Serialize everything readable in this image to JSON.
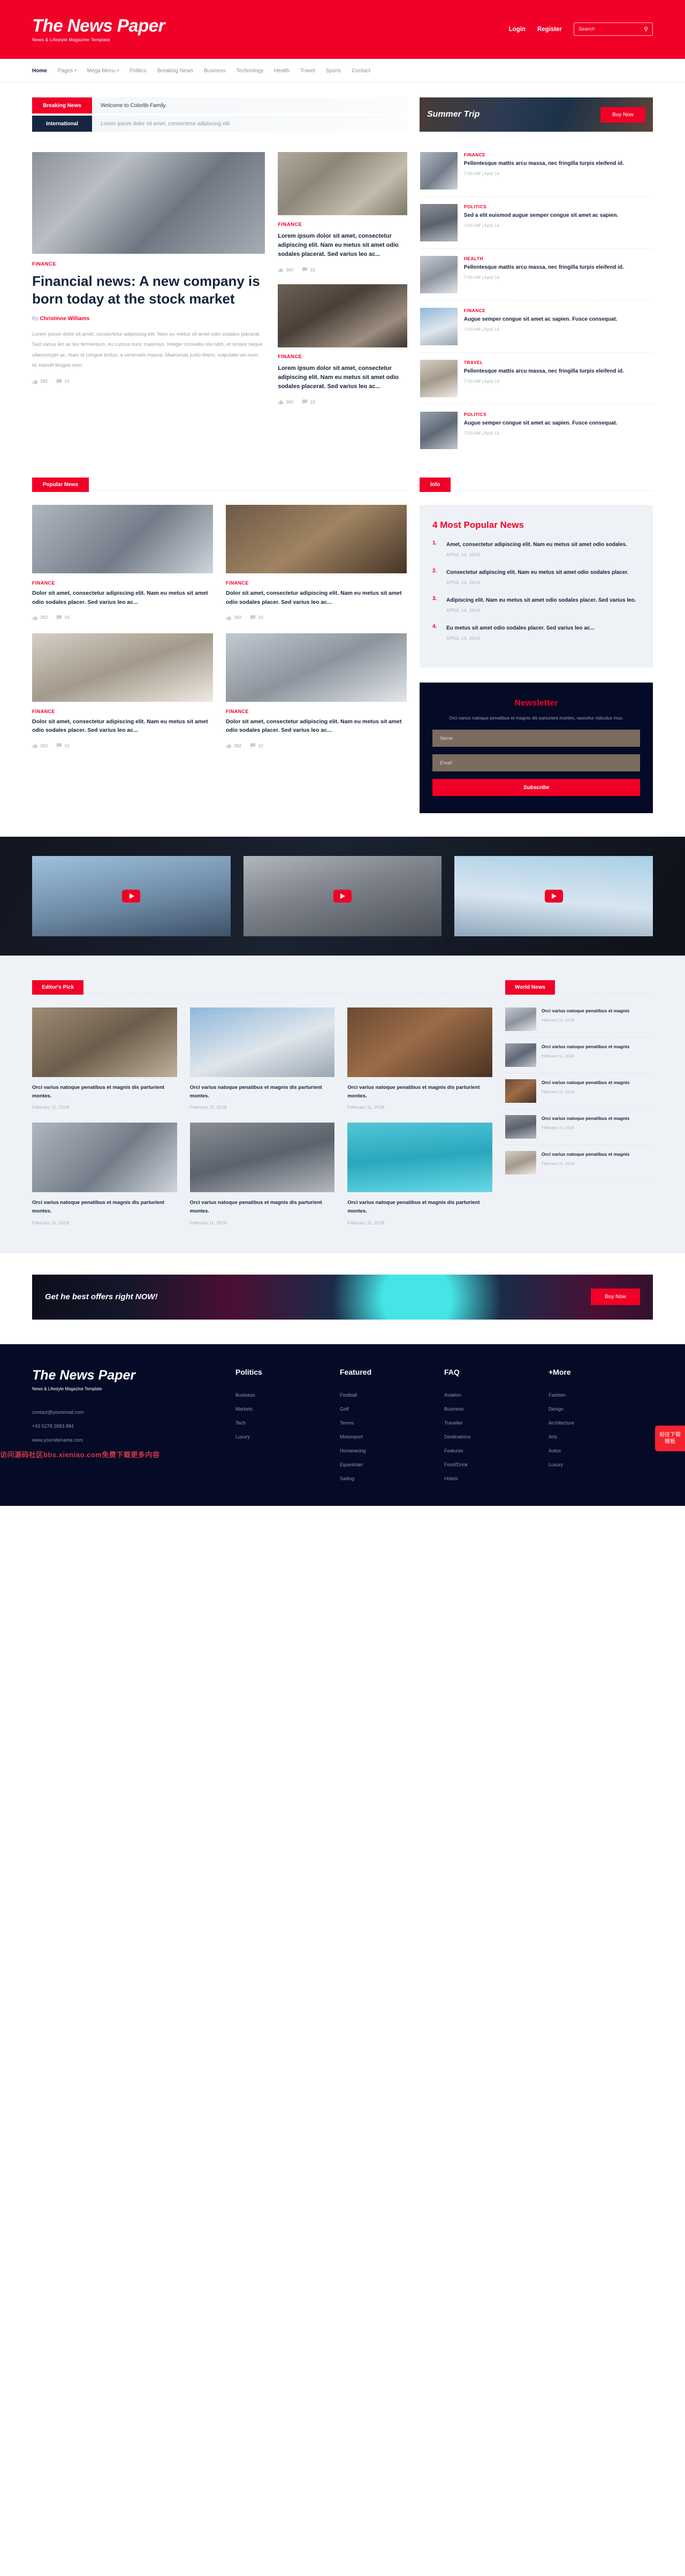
{
  "brand": {
    "title": "The News Paper",
    "tagline": "News & Lifestyle Magazine Template"
  },
  "header": {
    "login": "Login",
    "register": "Register",
    "search_placeholder": "Search",
    "search_value": "",
    "search_icon": "search-icon"
  },
  "nav": [
    {
      "label": "Home",
      "caret": "",
      "active": true
    },
    {
      "label": "Pages",
      "caret": "⌄",
      "active": false
    },
    {
      "label": "Mega Menu",
      "caret": "⌄",
      "active": false
    },
    {
      "label": "Politics",
      "caret": "",
      "active": false
    },
    {
      "label": "Breaking News",
      "caret": "",
      "active": false
    },
    {
      "label": "Business",
      "caret": "",
      "active": false
    },
    {
      "label": "Technology",
      "caret": "",
      "active": false
    },
    {
      "label": "Health",
      "caret": "",
      "active": false
    },
    {
      "label": "Travel",
      "caret": "",
      "active": false
    },
    {
      "label": "Sports",
      "caret": "",
      "active": false
    },
    {
      "label": "Contact",
      "caret": "",
      "active": false
    }
  ],
  "tickers": [
    {
      "tag": "Breaking News",
      "text": "Welcome to Colorlib Family."
    },
    {
      "tag": "International",
      "text": "Lorem ipsum dolor sit amet, consectetur adipiscing elit."
    }
  ],
  "promo": {
    "title": "Summer Trip",
    "button": "Buy Now"
  },
  "hero": {
    "category": "FINANCE",
    "title": "Financial news: A new company is born today at the stock market",
    "by_prefix": "By",
    "author": "Christinne Williams",
    "body": "Lorem ipsum dolor sit amet, consectetur adipiscing elit. Nam eu metus sit amet odio sodales placerat. Sed varius leo ac leo fermentum, eu cursus nunc maximus. Integer convallis nisi nibh, et ornare neque ullamcorper ac. Nam id congue lectus, a venenatis massa. Maecenas justo libero, vulputate vel nunc id, blandit feugiat sem.",
    "likes": "392",
    "comments": "10"
  },
  "hero_mid": [
    {
      "category": "FINANCE",
      "title": "Lorem ipsum dolor sit amet, consectetur adipiscing elit. Nam eu metus sit amet odio sodales placerat. Sed varius leo ac...",
      "likes": "392",
      "comments": "10"
    },
    {
      "category": "FINANCE",
      "title": "Lorem ipsum dolor sit amet, consectetur adipiscing elit. Nam eu metus sit amet odio sodales placerat. Sed varius leo ac...",
      "likes": "392",
      "comments": "10"
    }
  ],
  "sidebar_news": [
    {
      "category": "FINANCE",
      "title": "Pellentesque mattis arcu massa, nec fringilla turpis eleifend id.",
      "time": "7:00 AM | April 14"
    },
    {
      "category": "POLITICS",
      "title": "Sed a elit euismod augue semper congue sit amet ac sapien.",
      "time": "7:00 AM | April 14"
    },
    {
      "category": "HEALTH",
      "title": "Pellentesque mattis arcu massa, nec fringilla turpis eleifend id.",
      "time": "7:00 AM | April 14"
    },
    {
      "category": "FINANCE",
      "title": "Augue semper congue sit amet ac sapien. Fusce consequat.",
      "time": "7:00 AM | April 14"
    },
    {
      "category": "TRAVEL",
      "title": "Pellentesque mattis arcu massa, nec fringilla turpis eleifend id.",
      "time": "7:00 AM | April 14"
    },
    {
      "category": "POLITICS",
      "title": "Augue semper congue sit amet ac sapien. Fusce consequat.",
      "time": "7:00 AM | April 14"
    }
  ],
  "sections": {
    "popular_news": "Popular News",
    "info": "Info",
    "editors_pick": "Editor's Pick",
    "world_news": "World News"
  },
  "popular_cards": [
    {
      "category": "FINANCE",
      "title": "Dolor sit amet, consectetur adipiscing elit. Nam eu metus sit amet odio sodales placer. Sed varius leo ac...",
      "likes": "392",
      "comments": "10"
    },
    {
      "category": "FINANCE",
      "title": "Dolor sit amet, consectetur adipiscing elit. Nam eu metus sit amet odio sodales placer. Sed varius leo ac...",
      "likes": "392",
      "comments": "10"
    },
    {
      "category": "FINANCE",
      "title": "Dolor sit amet, consectetur adipiscing elit. Nam eu metus sit amet odio sodales placer. Sed varius leo ac...",
      "likes": "392",
      "comments": "10"
    },
    {
      "category": "FINANCE",
      "title": "Dolor sit amet, consectetur adipiscing elit. Nam eu metus sit amet odio sodales placer. Sed varius leo ac...",
      "likes": "392",
      "comments": "10"
    }
  ],
  "popular_widget": {
    "heading": "4 Most Popular News",
    "items": [
      {
        "num": "1.",
        "title": "Amet, consectetur adipiscing elit. Nam eu metus sit amet odio sodales.",
        "date": "APRIL 14, 2018"
      },
      {
        "num": "2.",
        "title": "Consectetur adipiscing elit. Nam eu metus sit amet odio sodales placer.",
        "date": "APRIL 14, 2018"
      },
      {
        "num": "3.",
        "title": "Adipiscing elit. Nam eu metus sit amet odio sodales placer. Sed varius leo.",
        "date": "APRIL 14, 2018"
      },
      {
        "num": "4.",
        "title": "Eu metus sit amet odio sodales placer. Sed varius leo ac...",
        "date": "APRIL 14, 2018"
      }
    ]
  },
  "newsletter": {
    "heading": "Newsletter",
    "text": "Orci varius natoque penatibus et magnis dis parturient montes, nascetur ridiculus mus.",
    "name_placeholder": "Name",
    "email_placeholder": "Email",
    "name_value": "",
    "email_value": "",
    "button": "Subscribe"
  },
  "videos": [
    {
      "play_icon": "play-icon"
    },
    {
      "play_icon": "play-icon"
    },
    {
      "play_icon": "play-icon"
    }
  ],
  "editors_pick": [
    {
      "title": "Orci varius natoque penatibus et magnis dis parturient montes.",
      "date": "February 11, 2018"
    },
    {
      "title": "Orci varius natoque penatibus et magnis dis parturient montes.",
      "date": "February 11, 2018"
    },
    {
      "title": "Orci varius natoque penatibus et magnis dis parturient montes.",
      "date": "February 11, 2018"
    },
    {
      "title": "Orci varius natoque penatibus et magnis dis parturient montes.",
      "date": "February 11, 2018"
    },
    {
      "title": "Orci varius natoque penatibus et magnis dis parturient montes.",
      "date": "February 11, 2018"
    },
    {
      "title": "Orci varius natoque penatibus et magnis dis parturient montes.",
      "date": "February 11, 2018"
    }
  ],
  "world_news": [
    {
      "title": "Orci varius natoque penatibus et magnis",
      "date": "February 11, 2018"
    },
    {
      "title": "Orci varius natoque penatibus et magnis",
      "date": "February 11, 2018"
    },
    {
      "title": "Orci varius natoque penatibus et magnis",
      "date": "February 11, 2018"
    },
    {
      "title": "Orci varius natoque penatibus et magnis",
      "date": "February 11, 2018"
    },
    {
      "title": "Orci varius natoque penatibus et magnis",
      "date": "February 11, 2018"
    }
  ],
  "offer": {
    "title": "Get he best offers right NOW!",
    "button": "Buy Now"
  },
  "footer": {
    "contact": {
      "email": "contact@youremail.com",
      "phone": "+43 5278 2883 884",
      "site": "www.yoursitename.com"
    },
    "columns": [
      {
        "heading": "Politics",
        "links": [
          "Business",
          "Markets",
          "Tech",
          "Luxury"
        ]
      },
      {
        "heading": "Featured",
        "links": [
          "Football",
          "Golf",
          "Tennis",
          "Motorsport",
          "Horseracing",
          "Equestrian",
          "Sailing"
        ]
      },
      {
        "heading": "FAQ",
        "links": [
          "Aviation",
          "Business",
          "Traveller",
          "Destinations",
          "Features",
          "Food/Drink",
          "Hotels"
        ]
      },
      {
        "heading": "+More",
        "links": [
          "Fashion",
          "Design",
          "Architecture",
          "Arts",
          "Autos",
          "Luxury"
        ]
      }
    ],
    "watermark": "访问源码社区bbs.xieniao.com免费下载更多内容",
    "float_button": "前往下载模板"
  }
}
